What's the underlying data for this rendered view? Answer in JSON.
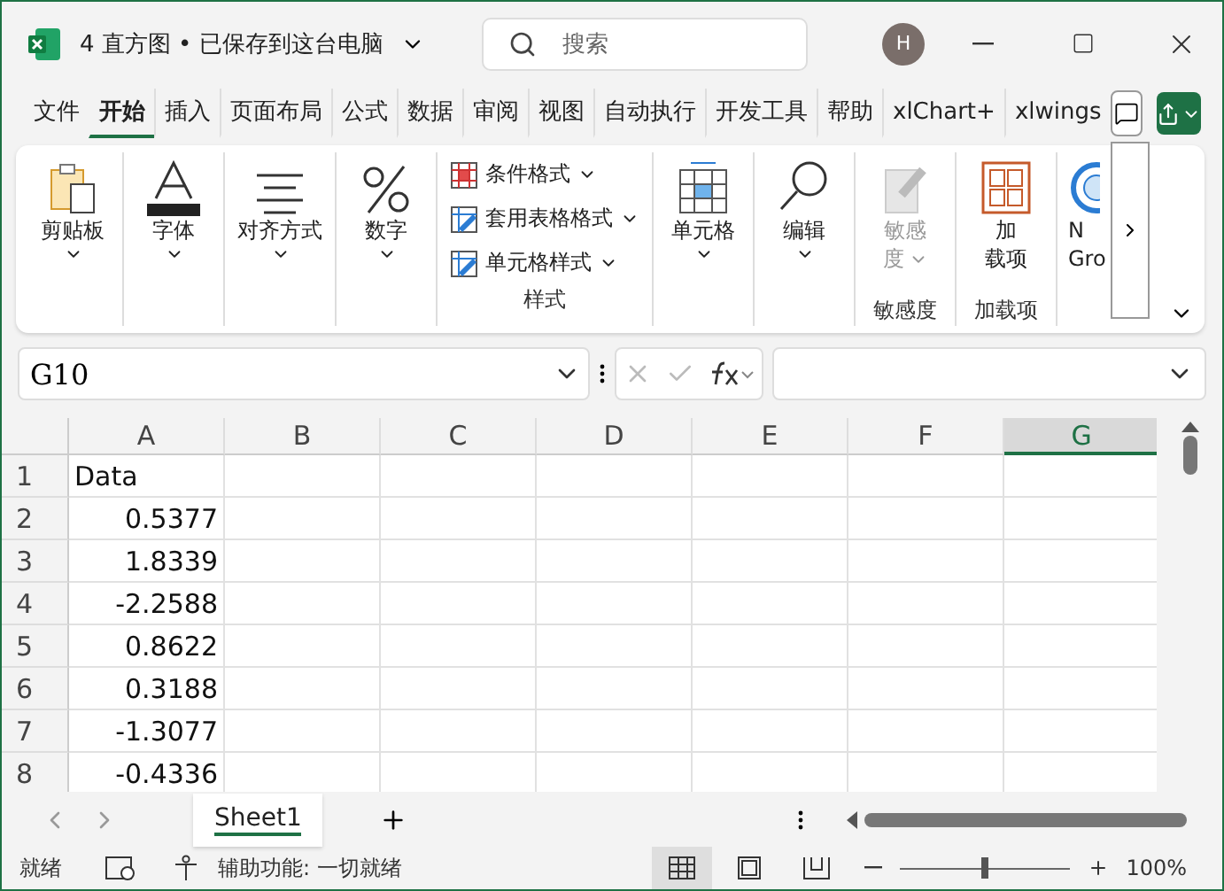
{
  "window": {
    "title": "4 直方图 • 已保存到这台电脑",
    "search_placeholder": "搜索",
    "avatar": "H"
  },
  "menu_tabs": [
    {
      "label": "文件",
      "selected": false
    },
    {
      "label": "开始",
      "selected": true
    },
    {
      "label": "插入",
      "selected": false
    },
    {
      "label": "页面布局",
      "selected": false
    },
    {
      "label": "公式",
      "selected": false
    },
    {
      "label": "数据",
      "selected": false
    },
    {
      "label": "审阅",
      "selected": false
    },
    {
      "label": "视图",
      "selected": false
    },
    {
      "label": "自动执行",
      "selected": false
    },
    {
      "label": "开发工具",
      "selected": false
    },
    {
      "label": "帮助",
      "selected": false
    },
    {
      "label": "xlChart+",
      "selected": false
    },
    {
      "label": "xlwings",
      "selected": false
    }
  ],
  "ribbon": [
    {
      "kind": "big",
      "lines": [
        "剪贴板"
      ],
      "caret": true,
      "disabled": false
    },
    {
      "kind": "big",
      "lines": [
        "字体"
      ],
      "caret": true,
      "disabled": false
    },
    {
      "kind": "big",
      "lines": [
        "对齐方式"
      ],
      "caret": true,
      "disabled": false
    },
    {
      "kind": "big",
      "lines": [
        "数字"
      ],
      "caret": true,
      "disabled": false
    },
    {
      "kind": "stack",
      "items": [
        "条件格式",
        "套用表格格式",
        "单元格样式"
      ],
      "group_label": "样式"
    },
    {
      "kind": "big",
      "lines": [
        "单元格"
      ],
      "caret": true,
      "disabled": false
    },
    {
      "kind": "big",
      "lines": [
        "编辑"
      ],
      "caret": true,
      "disabled": false
    },
    {
      "kind": "big",
      "lines": [
        "敏感",
        "度"
      ],
      "caret": true,
      "disabled": true,
      "group_label": "敏感度"
    },
    {
      "kind": "big",
      "lines": [
        "加",
        "载项"
      ],
      "caret": false,
      "disabled": false,
      "group_label": "加载项"
    },
    {
      "kind": "partial",
      "lines": [
        "N",
        "Gro"
      ]
    }
  ],
  "name_box": "G10",
  "columns": [
    {
      "label": "A",
      "selected": false
    },
    {
      "label": "B",
      "selected": false
    },
    {
      "label": "C",
      "selected": false
    },
    {
      "label": "D",
      "selected": false
    },
    {
      "label": "E",
      "selected": false
    },
    {
      "label": "F",
      "selected": false
    },
    {
      "label": "G",
      "selected": true
    }
  ],
  "rows": [
    {
      "label": "1",
      "cells": [
        {
          "kind": "text",
          "value": "Data"
        }
      ]
    },
    {
      "label": "2",
      "cells": [
        {
          "kind": "number",
          "value": "0.5377"
        }
      ]
    },
    {
      "label": "3",
      "cells": [
        {
          "kind": "number",
          "value": "1.8339"
        }
      ]
    },
    {
      "label": "4",
      "cells": [
        {
          "kind": "number",
          "value": "-2.2588"
        }
      ]
    },
    {
      "label": "5",
      "cells": [
        {
          "kind": "number",
          "value": "0.8622"
        }
      ]
    },
    {
      "label": "6",
      "cells": [
        {
          "kind": "number",
          "value": "0.3188"
        }
      ]
    },
    {
      "label": "7",
      "cells": [
        {
          "kind": "number",
          "value": "-1.3077"
        }
      ]
    },
    {
      "label": "8",
      "cells": [
        {
          "kind": "number",
          "value": "-0.4336"
        }
      ]
    }
  ],
  "sheets": [
    {
      "label": "Sheet1",
      "selected": true
    }
  ],
  "status": {
    "ready": "就绪",
    "accessibility": "辅助功能: 一切就绪",
    "views": [
      {
        "selected": true
      },
      {
        "selected": false
      },
      {
        "selected": false
      }
    ],
    "zoom": "100%",
    "level": 0.5
  }
}
